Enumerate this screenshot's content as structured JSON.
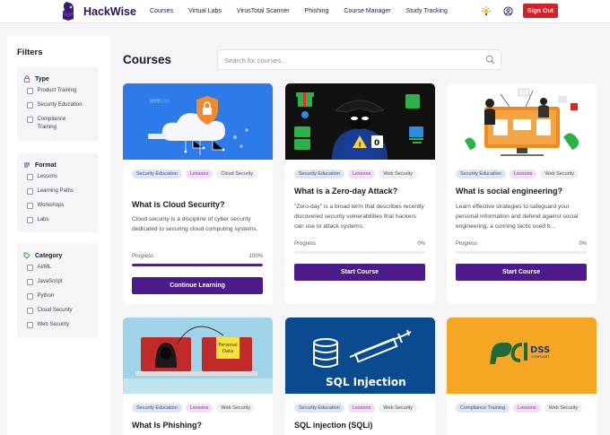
{
  "brand": {
    "name": "HackWise"
  },
  "nav": {
    "links": [
      "Courses",
      "Virtual Labs",
      "VirusTotal Scanner",
      "Phishing",
      "Course Manager",
      "Study Tracking"
    ],
    "sign_out": "Sign Out"
  },
  "sidebar": {
    "title": "Filters",
    "groups": [
      {
        "title": "Type",
        "icon": "lock-icon",
        "options": [
          "Product Training",
          "Security Education",
          "Compliance Training"
        ]
      },
      {
        "title": "Format",
        "icon": "list-icon",
        "options": [
          "Lessons",
          "Learning Paths",
          "Workshops",
          "Labs"
        ]
      },
      {
        "title": "Category",
        "icon": "tag-icon",
        "options": [
          "AI/ML",
          "JavaScript",
          "Python",
          "Cloud Security",
          "Web Security"
        ]
      }
    ]
  },
  "main": {
    "title": "Courses",
    "search_placeholder": "Search for courses...",
    "progress_label": "Progress",
    "cards": [
      {
        "tags": [
          "Security Education",
          "Lessons",
          "Cloud Security"
        ],
        "title": "What is Cloud Security?",
        "description": "Cloud security is a discipline of cyber security dedicated to securing cloud computing systems.",
        "progress_text": "100%",
        "progress": 1.0,
        "button": "Continue Learning"
      },
      {
        "tags": [
          "Security Education",
          "Lessons",
          "Web Security"
        ],
        "title": "What is a Zero-day Attack?",
        "description": "\"Zero-day\" is a broad term that describes recently discovered security vulnerabilities that hackers can use to attack systems.",
        "progress_text": "0%",
        "progress": 0.0,
        "button": "Start Course"
      },
      {
        "tags": [
          "Security Education",
          "Lessons",
          "Web Security"
        ],
        "title": "What is social engineering?",
        "description": "Learn effective strategies to safeguard your personal information and defend against social engineering, a cunning tactic used b...",
        "progress_text": "0%",
        "progress": 0.0,
        "button": "Start Course"
      },
      {
        "tags": [
          "Security Education",
          "Lessons",
          "Web Security"
        ],
        "title": "What Is Phishing?",
        "image_text": "Personal Data"
      },
      {
        "tags": [
          "Security Education",
          "Lessons",
          "Web Security"
        ],
        "title": "SQL injection (SQLi)",
        "image_text": "SQL Injection"
      },
      {
        "tags": [
          "Compliance Training",
          "Lessons",
          "Web Security"
        ],
        "title": "",
        "image_text": "PCI DSS COMPLIANT"
      }
    ]
  },
  "colors": {
    "primary": "#4b1b8c",
    "danger": "#d61f26",
    "brand": "#2a1454"
  }
}
